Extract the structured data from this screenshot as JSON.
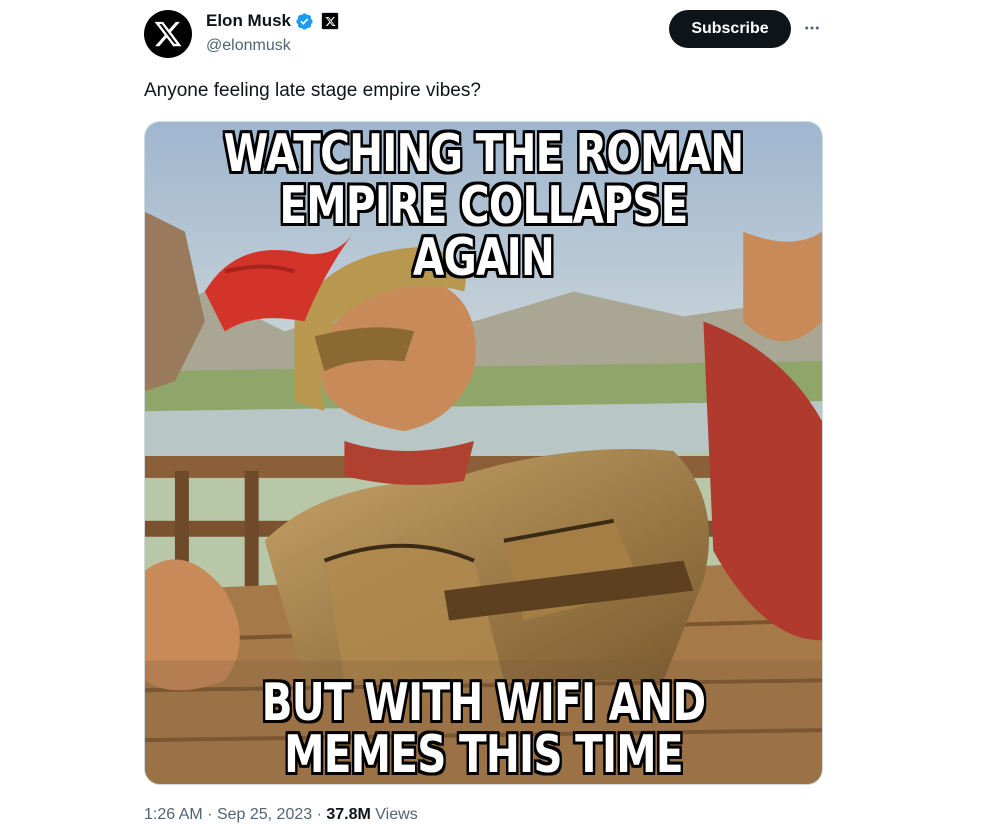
{
  "author": {
    "display_name": "Elon Musk",
    "handle": "@elonmusk",
    "verified_icon": "verified-badge-icon",
    "affiliation_icon": "x-logo-icon",
    "avatar_icon": "x-logo-icon"
  },
  "actions": {
    "subscribe_label": "Subscribe",
    "more_icon": "more-dots-icon"
  },
  "tweet": {
    "text": "Anyone feeling late stage empire vibes?",
    "media": {
      "top_caption_line1": "WATCHING THE ROMAN",
      "top_caption_line2": "EMPIRE COLLAPSE AGAIN",
      "bottom_caption_line1": "BUT WITH WIFI AND",
      "bottom_caption_line2": "MEMES THIS TIME"
    }
  },
  "meta": {
    "time": "1:26 AM",
    "separator": "·",
    "date": "Sep 25, 2023",
    "views_count": "37.8M",
    "views_label": "Views"
  },
  "colors": {
    "text_primary": "#0f1419",
    "text_secondary": "#536471",
    "verified_blue": "#1d9bf0",
    "button_dark": "#0f1419"
  }
}
